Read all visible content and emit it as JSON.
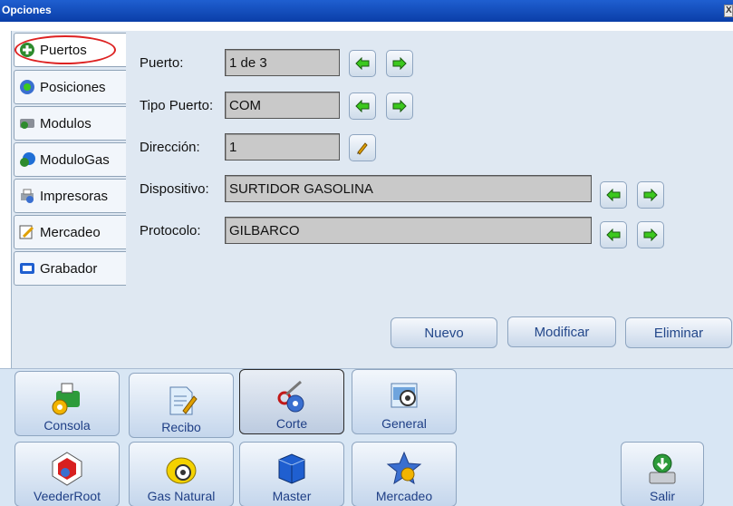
{
  "window": {
    "title": "Opciones",
    "close_glyph": "X"
  },
  "sidebar": {
    "items": [
      {
        "label": "Puertos",
        "icon": "port-icon",
        "active": true
      },
      {
        "label": "Posiciones",
        "icon": "positions-icon"
      },
      {
        "label": "Modulos",
        "icon": "module-icon"
      },
      {
        "label": "ModuloGas",
        "icon": "gas-module-icon"
      },
      {
        "label": "Impresoras",
        "icon": "printer-icon"
      },
      {
        "label": "Mercadeo",
        "icon": "marketing-icon"
      },
      {
        "label": "Grabador",
        "icon": "recorder-icon"
      }
    ]
  },
  "form": {
    "puerto": {
      "label": "Puerto:",
      "value": "1 de 3"
    },
    "tipo_puerto": {
      "label": "Tipo Puerto:",
      "value": "COM"
    },
    "direccion": {
      "label": "Dirección:",
      "value": "1"
    },
    "dispositivo": {
      "label": "Dispositivo:",
      "value": "SURTIDOR GASOLINA"
    },
    "protocolo": {
      "label": "Protocolo:",
      "value": "GILBARCO"
    }
  },
  "actions": {
    "nuevo": "Nuevo",
    "modificar": "Modificar",
    "eliminar": "Eliminar"
  },
  "toolbar": {
    "row1": [
      "Consola",
      "Recibo",
      "Corte",
      "General"
    ],
    "row2": [
      "VeederRoot",
      "Gas Natural",
      "Master",
      "Mercadeo"
    ],
    "salir": "Salir",
    "selected": "Corte"
  },
  "colors": {
    "accent": "#23478a",
    "highlight": "#dd2222",
    "arrow_green": "#3cc81e"
  }
}
